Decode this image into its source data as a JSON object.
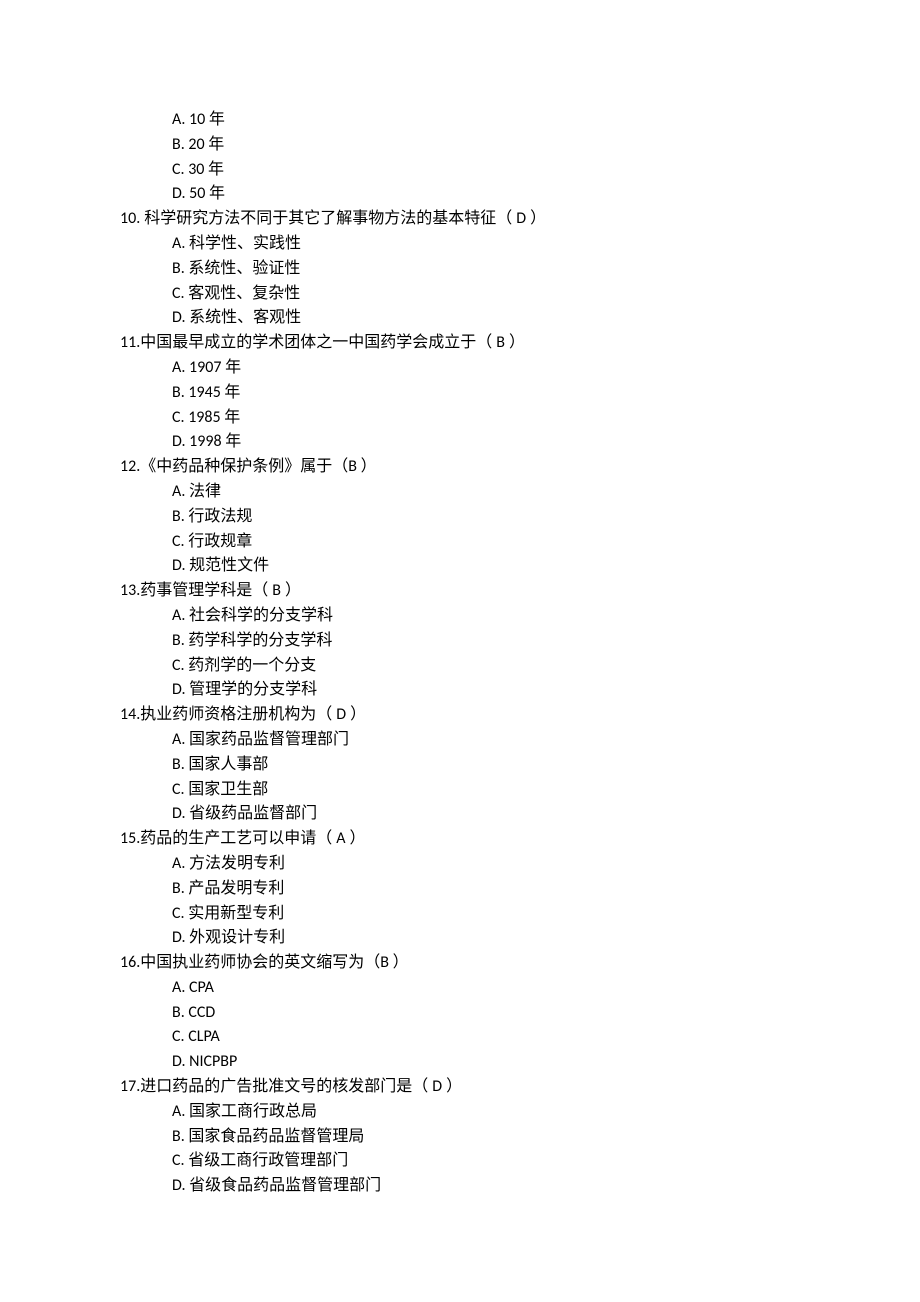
{
  "orphan_options": [
    {
      "label": "A. 10 ",
      "text": "年"
    },
    {
      "label": "B. 20 ",
      "text": "年"
    },
    {
      "label": "C. 30 ",
      "text": "年"
    },
    {
      "label": "D. 50 ",
      "text": "年"
    }
  ],
  "questions": [
    {
      "num": "10.",
      "num_pad": " ",
      "stem": "科学研究方法不同于其它了解事物方法的基本特征（   ",
      "answer": "D",
      "tail": "       ）",
      "options": [
        {
          "label": "A. ",
          "text": "科学性、实践性"
        },
        {
          "label": "B. ",
          "text": "系统性、验证性"
        },
        {
          "label": "C. ",
          "text": "客观性、复杂性"
        },
        {
          "label": "D. ",
          "text": "系统性、客观性"
        }
      ]
    },
    {
      "num": "11.",
      "num_pad": "",
      "stem": "中国最早成立的学术团体之一中国药学会成立于（   ",
      "answer": "B",
      "tail": "        ）",
      "options": [
        {
          "label": "A. 1907 ",
          "text": "年"
        },
        {
          "label": "B. 1945 ",
          "text": "年"
        },
        {
          "label": "C. 1985 ",
          "text": "年"
        },
        {
          "label": "D. 1998 ",
          "text": "年"
        }
      ]
    },
    {
      "num": "12.",
      "num_pad": "",
      "stem": "《中药品种保护条例》属于（",
      "answer": "B ",
      "tail": "）",
      "options": [
        {
          "label": "A. ",
          "text": "法律"
        },
        {
          "label": "B. ",
          "text": "行政法规"
        },
        {
          "label": "C. ",
          "text": "行政规章"
        },
        {
          "label": "D. ",
          "text": "规范性文件"
        }
      ]
    },
    {
      "num": "13.",
      "num_pad": "",
      "stem": "药事管理学科是（   ",
      "answer": "B",
      "tail": "        ）",
      "options": [
        {
          "label": "A. ",
          "text": "社会科学的分支学科"
        },
        {
          "label": "B. ",
          "text": "药学科学的分支学科"
        },
        {
          "label": "C. ",
          "text": "药剂学的一个分支"
        },
        {
          "label": "D. ",
          "text": "管理学的分支学科"
        }
      ]
    },
    {
      "num": "14.",
      "num_pad": "",
      "stem": "执业药师资格注册机构为（   ",
      "answer": "D",
      "tail": "        ）",
      "options": [
        {
          "label": "A. ",
          "text": "国家药品监督管理部门"
        },
        {
          "label": "B. ",
          "text": "国家人事部"
        },
        {
          "label": "C. ",
          "text": "国家卫生部"
        },
        {
          "label": "D. ",
          "text": "省级药品监督部门"
        }
      ]
    },
    {
      "num": "15.",
      "num_pad": "",
      "stem": "药品的生产工艺可以申请（    ",
      "answer": "A",
      "tail": "        ）",
      "options": [
        {
          "label": "A. ",
          "text": "方法发明专利"
        },
        {
          "label": "B. ",
          "text": "产品发明专利"
        },
        {
          "label": "C. ",
          "text": "实用新型专利"
        },
        {
          "label": "D. ",
          "text": "外观设计专利"
        }
      ]
    },
    {
      "num": "16.",
      "num_pad": "",
      "stem": "中国执业药师协会的英文缩写为（",
      "answer": "B ",
      "tail": "）",
      "options": [
        {
          "label": "A. CPA",
          "text": ""
        },
        {
          "label": "B. CCD",
          "text": ""
        },
        {
          "label": "C. CLPA",
          "text": ""
        },
        {
          "label": "D. NICPBP",
          "text": ""
        }
      ]
    },
    {
      "num": "17.",
      "num_pad": "",
      "stem": "进口药品的广告批准文号的核发部门是（ ",
      "answer": "D",
      "tail": "     ）",
      "options": [
        {
          "label": "A. ",
          "text": "国家工商行政总局"
        },
        {
          "label": "B. ",
          "text": "国家食品药品监督管理局"
        },
        {
          "label": "C. ",
          "text": "省级工商行政管理部门"
        },
        {
          "label": "D. ",
          "text": "省级食品药品监督管理部门"
        }
      ]
    }
  ]
}
